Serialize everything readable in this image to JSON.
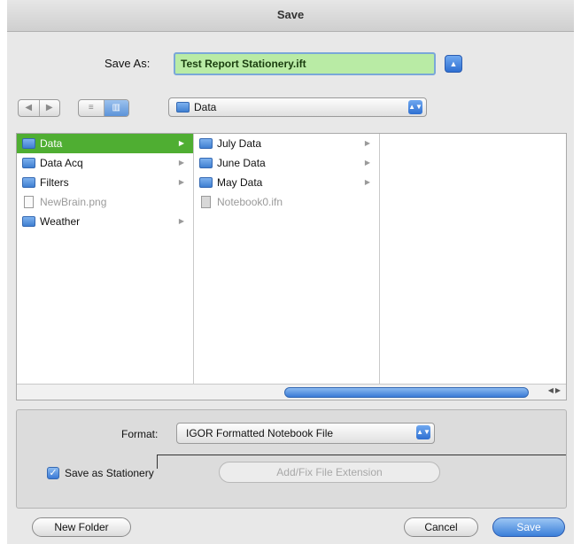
{
  "window": {
    "title": "Save"
  },
  "save_as": {
    "label": "Save As:",
    "value": "Test Report Stationery.ift"
  },
  "nav": {
    "back_symbol": "◀",
    "forward_symbol": "▶",
    "list_view_symbol": "≡",
    "column_view_symbol": "▥",
    "current_folder": "Data"
  },
  "browser": {
    "column1": [
      {
        "name": "Data",
        "type": "folder",
        "selected": true
      },
      {
        "name": "Data Acq",
        "type": "folder"
      },
      {
        "name": "Filters",
        "type": "folder"
      },
      {
        "name": "NewBrain.png",
        "type": "file",
        "disabled": true
      },
      {
        "name": "Weather",
        "type": "folder"
      }
    ],
    "column2": [
      {
        "name": "July Data",
        "type": "folder"
      },
      {
        "name": "June Data",
        "type": "folder"
      },
      {
        "name": "May Data",
        "type": "folder"
      },
      {
        "name": "Notebook0.ifn",
        "type": "file",
        "disabled": true
      }
    ]
  },
  "format": {
    "label": "Format:",
    "value": "IGOR Formatted Notebook File"
  },
  "stationery": {
    "label": "Save as Stationery",
    "checked": true
  },
  "add_extension": {
    "label": "Add/Fix File Extension"
  },
  "buttons": {
    "new_folder": "New Folder",
    "cancel": "Cancel",
    "save": "Save"
  },
  "colors": {
    "selection": "#4fae32",
    "accent": "#3a7ad6",
    "filename_field": "#b9eba5"
  }
}
